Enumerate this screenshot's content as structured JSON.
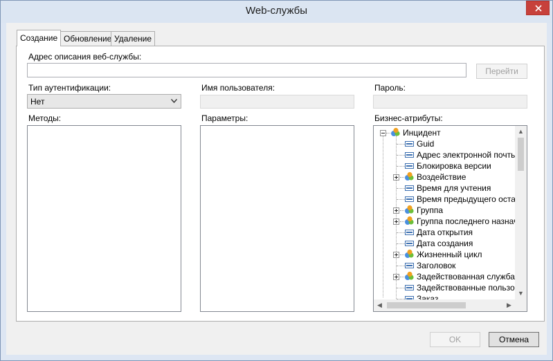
{
  "window": {
    "title": "Web-службы"
  },
  "tabs": [
    {
      "label": "Создание",
      "active": true
    },
    {
      "label": "Обновление",
      "active": false
    },
    {
      "label": "Удаление",
      "active": false
    }
  ],
  "form": {
    "wsdl_label": "Адрес описания веб-службы:",
    "wsdl_value": "",
    "go_button": "Перейти",
    "auth_label": "Тип аутентификации:",
    "auth_value": "Нет",
    "user_label": "Имя пользователя:",
    "user_value": "",
    "password_label": "Пароль:",
    "password_value": "",
    "methods_label": "Методы:",
    "params_label": "Параметры:",
    "attrs_label": "Бизнес-атрибуты:"
  },
  "tree": {
    "root": {
      "label": "Инцидент",
      "icon": "entity-icon",
      "expanded": true
    },
    "children": [
      {
        "label": "Guid",
        "kind": "field"
      },
      {
        "label": "Адрес электронной почты о",
        "kind": "field"
      },
      {
        "label": "Блокировка версии",
        "kind": "field"
      },
      {
        "label": "Воздействие",
        "kind": "entity"
      },
      {
        "label": "Время для учтения",
        "kind": "field"
      },
      {
        "label": "Время предыдущего останс",
        "kind": "field"
      },
      {
        "label": "Группа",
        "kind": "entity"
      },
      {
        "label": "Группа последнего назначе",
        "kind": "entity"
      },
      {
        "label": "Дата открытия",
        "kind": "field"
      },
      {
        "label": "Дата создания",
        "kind": "field"
      },
      {
        "label": "Жизненный цикл",
        "kind": "entity"
      },
      {
        "label": "Заголовок",
        "kind": "field"
      },
      {
        "label": "Задействованная служба",
        "kind": "entity"
      },
      {
        "label": "Задействованные пользова",
        "kind": "field"
      },
      {
        "label": "Заказ",
        "kind": "field"
      }
    ]
  },
  "footer": {
    "ok_button": "OK",
    "cancel_button": "Отмена"
  },
  "colors": {
    "close": "#c7413b",
    "field_icon": "#3c6fb0",
    "entity_green": "#6cbf3a",
    "entity_orange": "#f0a020",
    "entity_blue": "#4a8fe0"
  }
}
